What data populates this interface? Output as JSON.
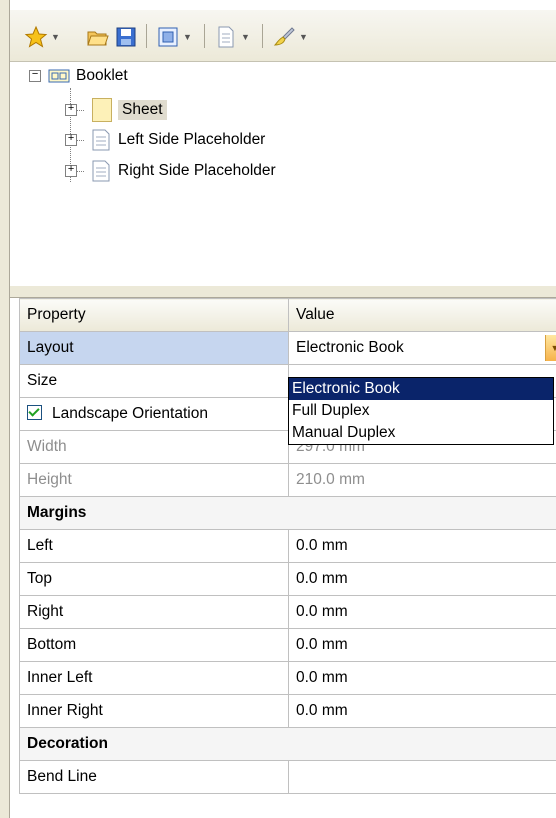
{
  "tree": {
    "root": "Booklet",
    "children": [
      "Sheet",
      "Left Side Placeholder",
      "Right Side Placeholder"
    ]
  },
  "grid": {
    "header": {
      "property": "Property",
      "value": "Value"
    },
    "rows": [
      {
        "name": "Layout",
        "value": "Electronic Book"
      },
      {
        "name": "Size",
        "value": ""
      },
      {
        "name": "Landscape Orientation",
        "value": ""
      },
      {
        "name": "Width",
        "value": "297.0 mm"
      },
      {
        "name": "Height",
        "value": "210.0 mm"
      },
      {
        "category": "Margins"
      },
      {
        "name": "Left",
        "value": "0.0 mm"
      },
      {
        "name": "Top",
        "value": "0.0 mm"
      },
      {
        "name": "Right",
        "value": "0.0 mm"
      },
      {
        "name": "Bottom",
        "value": "0.0 mm"
      },
      {
        "name": "Inner Left",
        "value": "0.0 mm"
      },
      {
        "name": "Inner Right",
        "value": "0.0 mm"
      },
      {
        "category": "Decoration"
      },
      {
        "name": "Bend Line",
        "value": ""
      }
    ]
  },
  "dropdown": {
    "options": [
      "Electronic Book",
      "Full Duplex",
      "Manual Duplex"
    ],
    "selected": "Electronic Book"
  },
  "colors": {
    "selection": "#0a246a",
    "selected_row": "#c6d6ef"
  },
  "icons": [
    "star-icon",
    "open-folder-icon",
    "save-icon",
    "document-view-icon",
    "page-icon",
    "brush-icon"
  ]
}
